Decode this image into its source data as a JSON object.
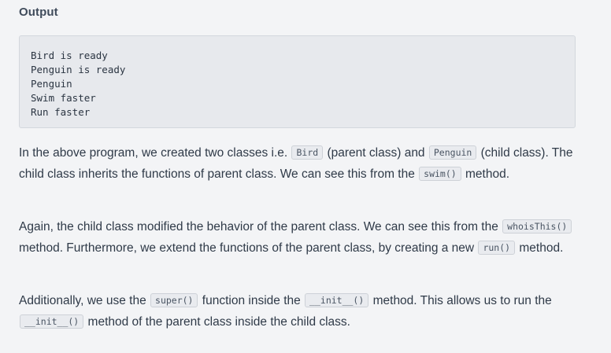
{
  "output": {
    "heading": "Output",
    "lines": "Bird is ready\nPenguin is ready\nPenguin\nSwim faster\nRun faster"
  },
  "paragraphs": {
    "p1": {
      "t1": "In the above program, we created two classes i.e. ",
      "c1": "Bird",
      "t2": " (parent class) and ",
      "c2": "Penguin",
      "t3": " (child class). The child class inherits the functions of parent class. We can see this from the ",
      "c3": "swim()",
      "t4": " method."
    },
    "p2": {
      "t1": "Again, the child class modified the behavior of the parent class. We can see this from the ",
      "c1": "whoisThis()",
      "t2": " method. Furthermore, we extend the functions of the parent class, by creating a new ",
      "c2": "run()",
      "t3": " method."
    },
    "p3": {
      "t1": "Additionally, we use the ",
      "c1": "super()",
      "t2": " function inside the ",
      "c2": "__init__()",
      "t3": " method. This allows us to run the ",
      "c3": "__init__()",
      "t4": " method of the parent class inside the child class."
    }
  }
}
